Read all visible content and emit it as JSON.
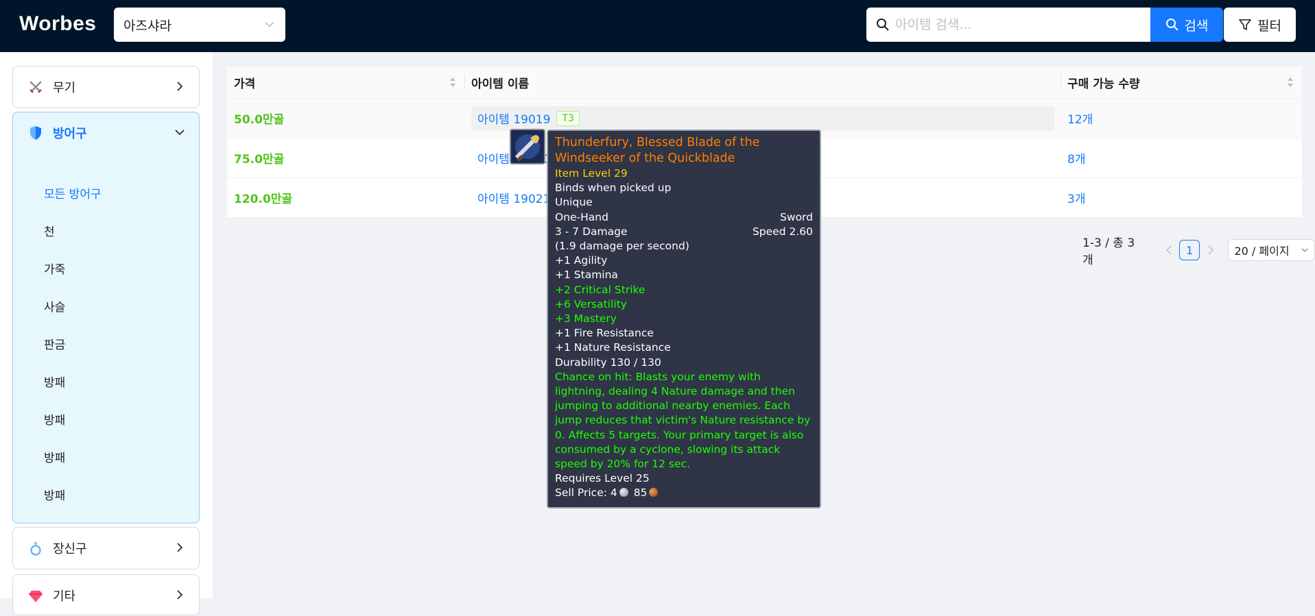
{
  "header": {
    "logo": "Worbes",
    "realm": "아즈샤라",
    "search_placeholder": "아이템 검색...",
    "search_label": "검색",
    "filter_label": "필터"
  },
  "sidebar": {
    "categories": [
      {
        "label": "무기",
        "icon": "crossed-swords-icon",
        "open": false
      },
      {
        "label": "방어구",
        "icon": "shield-icon",
        "open": true,
        "items": [
          "모든 방어구",
          "천",
          "가죽",
          "사슬",
          "판금",
          "방패",
          "방패",
          "방패",
          "방패"
        ],
        "active_item": 0
      },
      {
        "label": "장신구",
        "icon": "ring-icon",
        "open": false
      },
      {
        "label": "기타",
        "icon": "gem-icon",
        "open": false
      }
    ]
  },
  "table": {
    "columns": [
      "가격",
      "아이템 이름",
      "구매 가능 수량"
    ],
    "rows": [
      {
        "price": "50.0만골",
        "name": "아이템 19019",
        "tag": "T3",
        "qty": "12개"
      },
      {
        "price": "75.0만골",
        "name": "아이템 19020",
        "tag": "",
        "qty": "8개"
      },
      {
        "price": "120.0만골",
        "name": "아이템 19021",
        "tag": "",
        "qty": "3개"
      }
    ]
  },
  "pagination": {
    "total": "1-3 / 총 3개",
    "current": "1",
    "page_size": "20 / 페이지"
  },
  "tooltip": {
    "name": "Thunderfury, Blessed Blade of the Windseeker of the Quickblade",
    "item_level": "Item Level 29",
    "binds": "Binds when picked up",
    "unique": "Unique",
    "slot": "One-Hand",
    "type": "Sword",
    "damage": "3 - 7 Damage",
    "speed": "Speed 2.60",
    "dps": "(1.9 damage per second)",
    "stats_white": [
      "+1 Agility",
      "+1 Stamina"
    ],
    "stats_green": [
      "+2 Critical Strike",
      "+6 Versatility",
      "+3 Mastery"
    ],
    "resistances": [
      "+1 Fire Resistance",
      "+1 Nature Resistance"
    ],
    "durability": "Durability 130 / 130",
    "effect": "Chance on hit: Blasts your enemy with lightning, dealing 4 Nature damage and then jumping to additional nearby enemies.  Each jump reduces that victim's Nature resistance by 0. Affects 5 targets. Your primary target is also consumed by a cyclone, slowing its attack speed by 20% for 12 sec.",
    "requires": "Requires Level 25",
    "sell_label": "Sell Price:",
    "sell_silver": "4",
    "sell_copper": "85"
  }
}
